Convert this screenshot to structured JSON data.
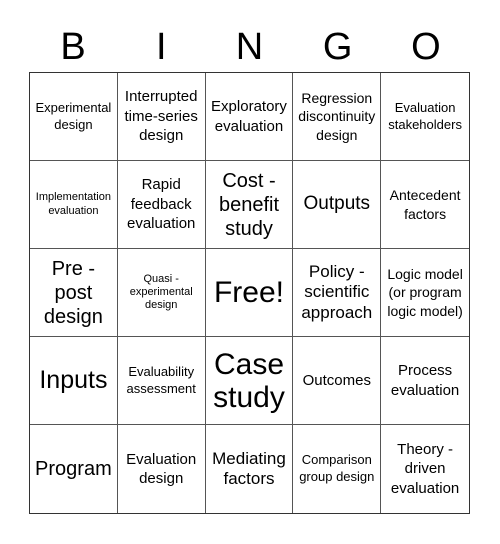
{
  "header": {
    "letters": [
      "B",
      "I",
      "N",
      "G",
      "O"
    ]
  },
  "cells": [
    {
      "text": "Experimental design",
      "size": "s13"
    },
    {
      "text": "Interrupted time-series design",
      "size": "s15"
    },
    {
      "text": "Exploratory evaluation",
      "size": "s15"
    },
    {
      "text": "Regression discontinuity design",
      "size": "s14"
    },
    {
      "text": "Evaluation stakeholders",
      "size": "s13"
    },
    {
      "text": "Implementation evaluation",
      "size": "s11"
    },
    {
      "text": "Rapid feedback evaluation",
      "size": "s15"
    },
    {
      "text": "Cost - benefit study",
      "size": "s20"
    },
    {
      "text": "Outputs",
      "size": "s19"
    },
    {
      "text": "Antecedent factors",
      "size": "s14"
    },
    {
      "text": "Pre - post design",
      "size": "s20"
    },
    {
      "text": "Quasi - experimental design",
      "size": "s11"
    },
    {
      "text": "Free!",
      "size": "s30"
    },
    {
      "text": "Policy - scientific approach",
      "size": "s17"
    },
    {
      "text": "Logic model (or program logic model)",
      "size": "s14"
    },
    {
      "text": "Inputs",
      "size": "s25"
    },
    {
      "text": "Evaluability assessment",
      "size": "s13"
    },
    {
      "text": "Case study",
      "size": "s30"
    },
    {
      "text": "Outcomes",
      "size": "s15"
    },
    {
      "text": "Process evaluation",
      "size": "s15"
    },
    {
      "text": "Program",
      "size": "s20"
    },
    {
      "text": "Evaluation design",
      "size": "s15"
    },
    {
      "text": "Mediating factors",
      "size": "s17"
    },
    {
      "text": "Comparison group design",
      "size": "s13"
    },
    {
      "text": "Theory - driven evaluation",
      "size": "s15"
    }
  ]
}
